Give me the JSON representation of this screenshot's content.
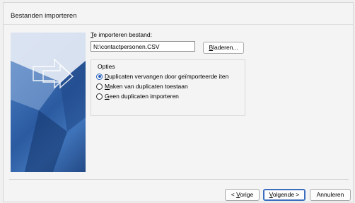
{
  "dialog": {
    "title": "Bestanden importeren"
  },
  "file": {
    "label_accel": "T",
    "label_rest": "e importeren bestand:",
    "value": "N:\\contactpersonen.CSV",
    "browse_accel": "B",
    "browse_rest": "laderen..."
  },
  "options": {
    "title": "Opties",
    "items": [
      {
        "pre": "",
        "accel": "D",
        "post": "uplicaten vervangen door geïmporteerde iten",
        "selected": true
      },
      {
        "pre": "",
        "accel": "M",
        "post": "aken van duplicaten toestaan",
        "selected": false
      },
      {
        "pre": "",
        "accel": "G",
        "post": "een duplicaten importeren",
        "selected": false
      }
    ]
  },
  "buttons": {
    "back_pre": "< ",
    "back_accel": "V",
    "back_post": "orige",
    "next_accel": "V",
    "next_post": "olgende >",
    "cancel": "Annuleren"
  }
}
